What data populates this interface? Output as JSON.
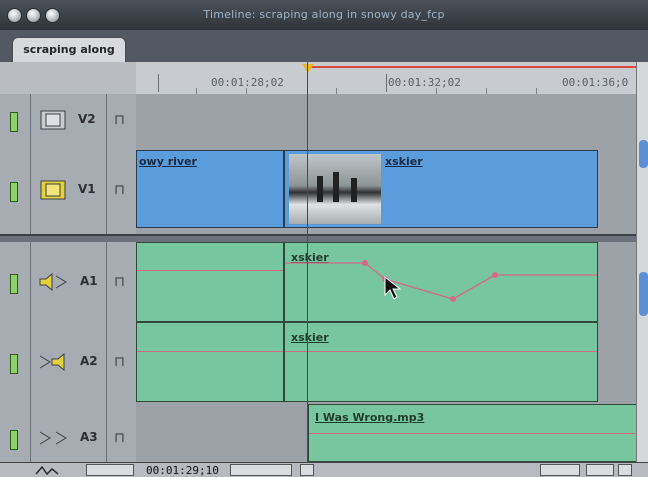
{
  "window": {
    "title": "Timeline: scraping along in snowy day_fcp"
  },
  "tab": {
    "label": "scraping along"
  },
  "ruler": {
    "timecodes": [
      "00:01:28;02",
      "00:01:32;02",
      "00:01:36;0"
    ]
  },
  "tracks": {
    "v2": {
      "label": "V2"
    },
    "v1": {
      "label": "V1"
    },
    "a1": {
      "label": "A1"
    },
    "a2": {
      "label": "A2"
    },
    "a3": {
      "label": "A3"
    }
  },
  "clips": {
    "v1_left": "owy river",
    "v1_right": "xskier",
    "a1": "xskier",
    "a2": "xskier",
    "a3": "I Was Wrong.mp3"
  },
  "footer": {
    "timecode": "00:01:29;10"
  },
  "colors": {
    "video_clip": "#5b9ddc",
    "audio_clip": "#78c6a0",
    "level_line": "#d36a86",
    "in_out_bar": "#d9493f"
  },
  "icons": [
    "film-strip-icon",
    "speaker-icon",
    "lock-icon",
    "track-visibility-icon"
  ]
}
